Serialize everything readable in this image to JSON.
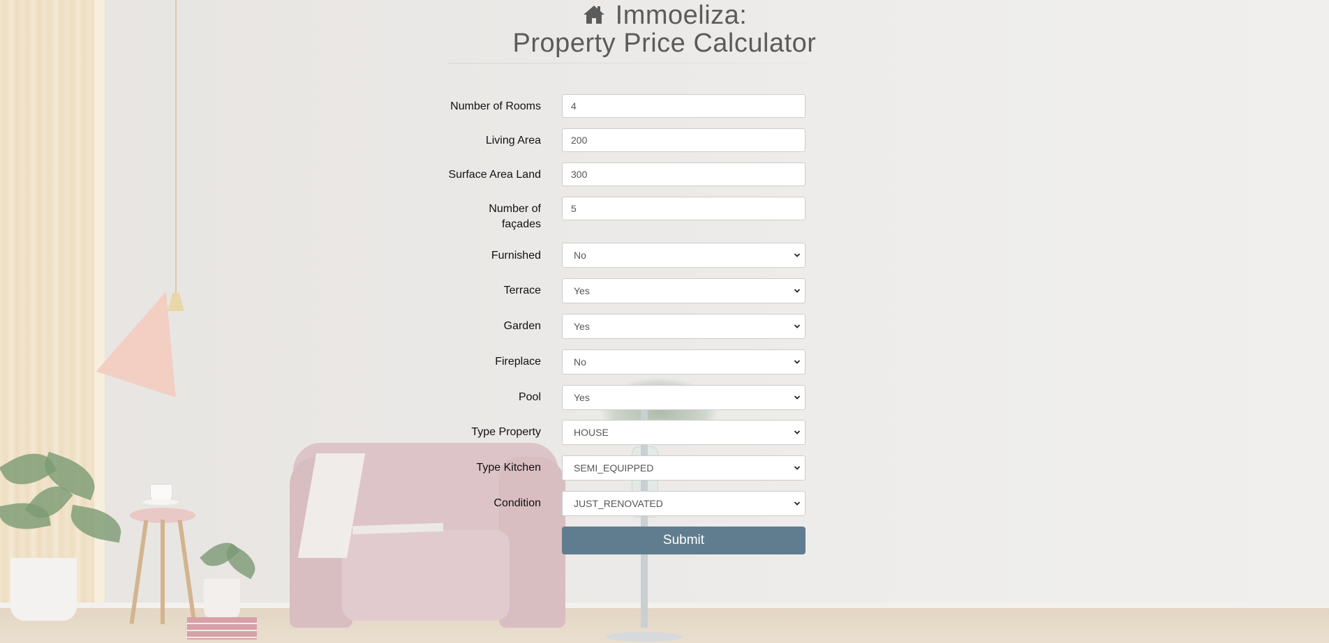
{
  "header": {
    "title_line1": "Immoeliza:",
    "title_line2": "Property Price Calculator",
    "icon": "home-icon"
  },
  "form": {
    "rooms": {
      "label": "Number of Rooms",
      "value": "4"
    },
    "living_area": {
      "label": "Living Area",
      "value": "200"
    },
    "land_area": {
      "label": "Surface Area Land",
      "value": "300"
    },
    "facades": {
      "label_line1": "Number of",
      "label_line2": "façades",
      "value": "5"
    },
    "furnished": {
      "label": "Furnished",
      "value": "No"
    },
    "terrace": {
      "label": "Terrace",
      "value": "Yes"
    },
    "garden": {
      "label": "Garden",
      "value": "Yes"
    },
    "fireplace": {
      "label": "Fireplace",
      "value": "No"
    },
    "pool": {
      "label": "Pool",
      "value": "Yes"
    },
    "type_property": {
      "label": "Type Property",
      "value": "HOUSE"
    },
    "type_kitchen": {
      "label": "Type Kitchen",
      "value": "SEMI_EQUIPPED"
    },
    "condition": {
      "label": "Condition",
      "value": "JUST_RENOVATED"
    },
    "submit_label": "Submit"
  },
  "colors": {
    "submit_bg": "#5f7d8e",
    "title_text": "#5b5b5b"
  }
}
